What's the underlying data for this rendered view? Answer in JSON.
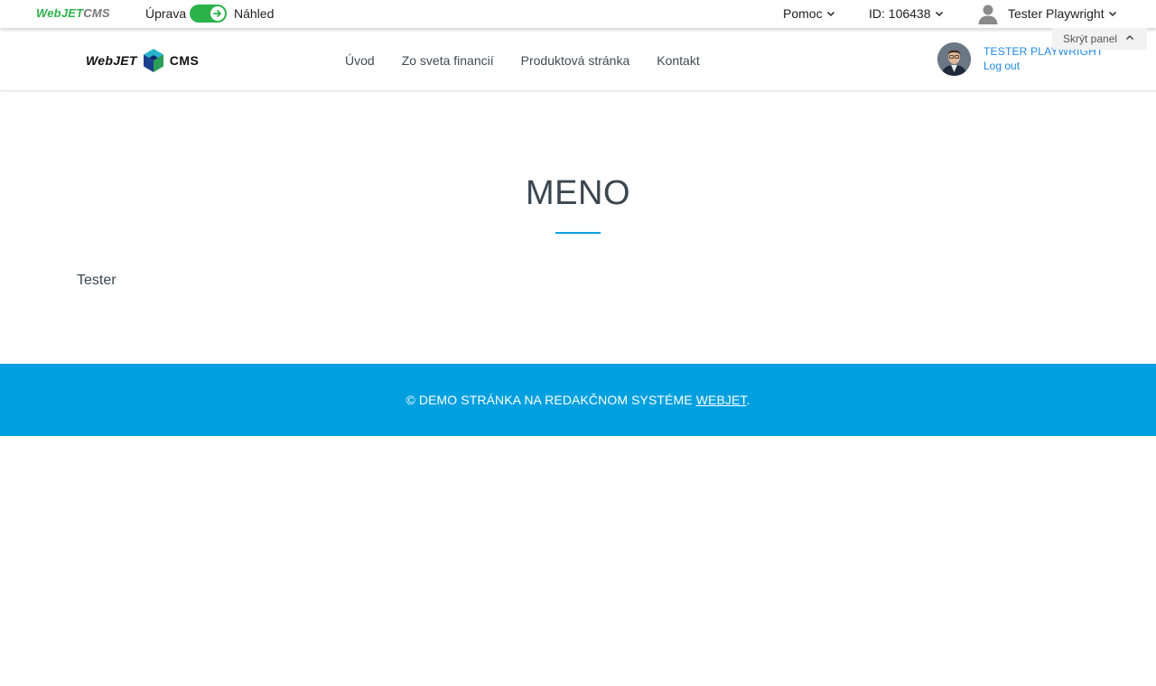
{
  "admin_bar": {
    "logo": {
      "part1": "Web",
      "part2": "JET",
      "part3": "CMS"
    },
    "mode_edit_label": "Úprava",
    "mode_preview_label": "Náhled",
    "help_label": "Pomoc",
    "id_label": "ID: 106438",
    "user_label": "Tester Playwright",
    "hide_panel_label": "Skrýt panel"
  },
  "site_header": {
    "logo": {
      "left": "WebJET",
      "right": "CMS"
    },
    "nav": [
      {
        "label": "Úvod"
      },
      {
        "label": "Zo sveta financií"
      },
      {
        "label": "Produktová stránka"
      },
      {
        "label": "Kontakt"
      }
    ],
    "profile": {
      "name": "TESTER PLAYWRIGHT",
      "logout": "Log out"
    }
  },
  "main": {
    "title": "MENO",
    "text": "Tester"
  },
  "footer": {
    "prefix": "© DEMO STRÁNKA NA REDAKČNOM SYSTÉME ",
    "link": "WEBJET",
    "suffix": "."
  },
  "colors": {
    "admin_green": "#2bb34a",
    "accent_blue": "#00a0e0",
    "link_blue": "#1e88e5",
    "heading": "#3a4650"
  },
  "icons": [
    "arrow-right-icon",
    "chevron-down-icon",
    "user-icon",
    "chevron-up-icon",
    "cube-logo-icon"
  ]
}
